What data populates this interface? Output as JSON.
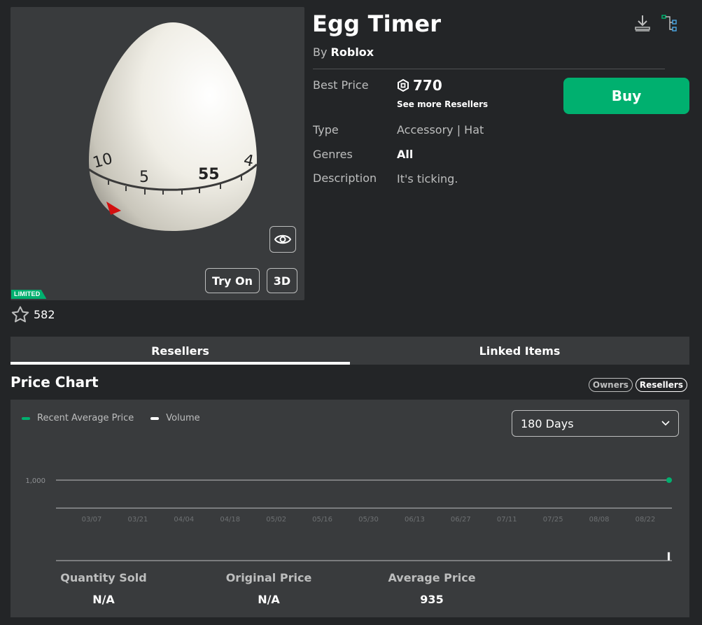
{
  "item": {
    "title": "Egg Timer",
    "by_prefix": "By",
    "creator": "Roblox",
    "limited_badge": "LIMITED",
    "favorites": "582",
    "try_on_label": "Try On",
    "three_d_label": "3D"
  },
  "details": {
    "best_price_label": "Best Price",
    "best_price_value": "770",
    "see_more_label": "See more Resellers",
    "buy_label": "Buy",
    "type_label": "Type",
    "type_value": "Accessory | Hat",
    "genres_label": "Genres",
    "genres_value": "All",
    "description_label": "Description",
    "description_value": "It's ticking."
  },
  "tabs": [
    {
      "label": "Resellers",
      "active": true
    },
    {
      "label": "Linked Items",
      "active": false
    }
  ],
  "price_chart": {
    "section_title": "Price Chart",
    "chips": [
      {
        "label": "Owners",
        "active": false
      },
      {
        "label": "Resellers",
        "active": true
      }
    ],
    "legend": [
      {
        "label": "Recent Average Price",
        "color": "#00b06f"
      },
      {
        "label": "Volume",
        "color": "#ffffff"
      }
    ],
    "range_selected": "180 Days"
  },
  "chart_data": {
    "type": "line",
    "x": [
      "03/07",
      "03/21",
      "04/04",
      "04/18",
      "05/02",
      "05/16",
      "05/30",
      "06/13",
      "06/27",
      "07/11",
      "07/25",
      "08/08",
      "08/22"
    ],
    "y_ticks": [
      "1,000"
    ],
    "series": [
      {
        "name": "Recent Average Price",
        "color": "#00b06f",
        "points": [
          {
            "x": "08/22",
            "y": 1000
          }
        ]
      },
      {
        "name": "Volume",
        "color": "#ffffff",
        "points": [
          {
            "x": "08/22",
            "y": 1
          }
        ]
      }
    ],
    "grid": true
  },
  "stats": [
    {
      "label": "Quantity Sold",
      "value": "N/A"
    },
    {
      "label": "Original Price",
      "value": "N/A"
    },
    {
      "label": "Average Price",
      "value": "935"
    }
  ]
}
